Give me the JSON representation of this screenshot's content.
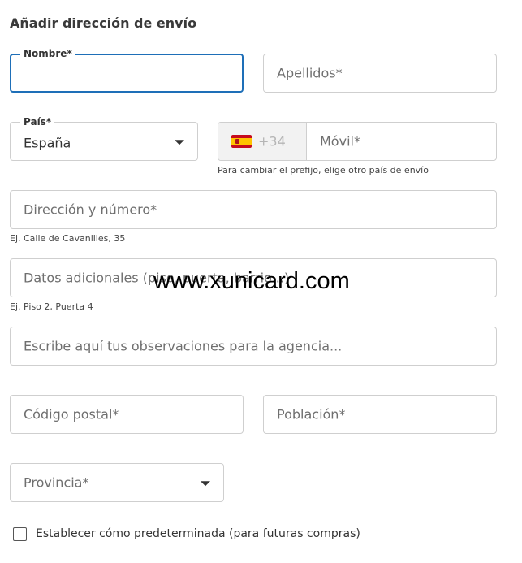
{
  "form": {
    "title": "Añadir dirección de envío",
    "nombre": {
      "label": "Nombre*",
      "value": ""
    },
    "apellidos": {
      "placeholder": "Apellidos*"
    },
    "pais": {
      "label": "País*",
      "value": "España"
    },
    "movil": {
      "prefix": "+34",
      "flag_icon": "spain-flag-icon",
      "placeholder": "Móvil*",
      "helper": "Para cambiar el prefijo, elige otro país de envío"
    },
    "direccion": {
      "placeholder": "Dirección y número*",
      "helper": "Ej. Calle de Cavanilles, 35"
    },
    "datos_adicionales": {
      "placeholder": "Datos adicionales (piso, puerta, barrio...)",
      "helper": "Ej. Piso 2, Puerta 4"
    },
    "observaciones": {
      "placeholder": "Escribe aquí tus observaciones para la agencia..."
    },
    "codigo_postal": {
      "placeholder": "Código postal*"
    },
    "poblacion": {
      "placeholder": "Población*"
    },
    "provincia": {
      "placeholder": "Provincia*"
    },
    "predeterminada": {
      "label": "Establecer cómo predeterminada (para futuras compras)",
      "checked": false
    }
  },
  "watermark": "www.xunicard.com",
  "colors": {
    "focus_border": "#1e6fb8",
    "border": "#cfcfcf",
    "prefix_bg": "#f2f2f2"
  }
}
